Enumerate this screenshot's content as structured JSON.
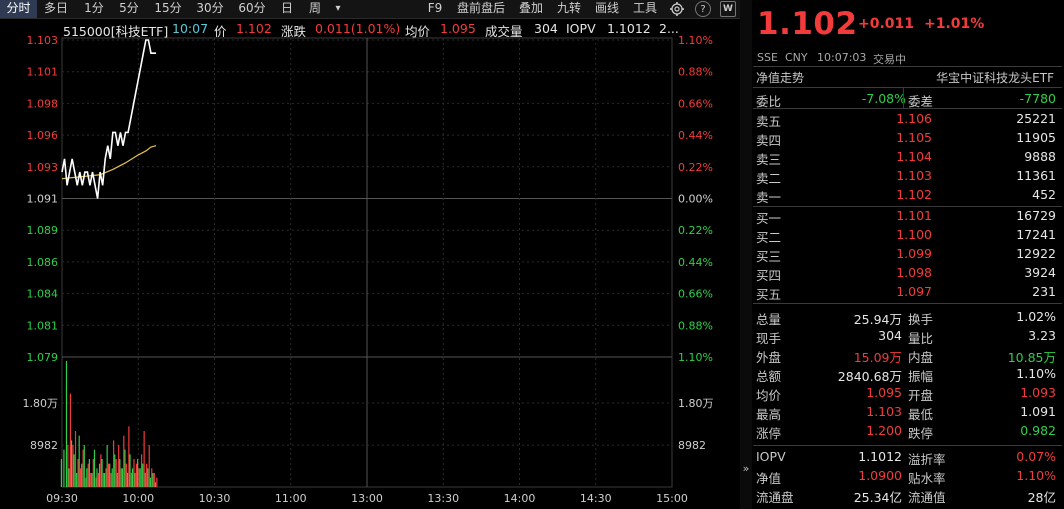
{
  "toolbar": {
    "periods": [
      {
        "label": "分时",
        "active": true
      },
      {
        "label": "多日"
      },
      {
        "label": "1分"
      },
      {
        "label": "5分"
      },
      {
        "label": "15分"
      },
      {
        "label": "30分"
      },
      {
        "label": "60分"
      },
      {
        "label": "日"
      },
      {
        "label": "周"
      }
    ],
    "more_arrow": "▾",
    "tools": [
      "F9",
      "盘前盘后",
      "叠加",
      "九转",
      "画线",
      "工具"
    ],
    "settings_icon": "gear-icon",
    "help_icon": "help-icon",
    "help_text": "?",
    "expand_icon": "expand-icon",
    "expand_text": "W"
  },
  "info": {
    "code_name": "515000[科技ETF]",
    "time": "10:07",
    "price_label": "价",
    "price": "1.102",
    "change_label": "涨跌",
    "change": "0.011(1.01%)",
    "avg_label": "均价",
    "avg": "1.095",
    "volume_label": "成交量",
    "volume": "304",
    "iopv_label": "IOPV",
    "iopv": "1.1012",
    "trailing": "2..."
  },
  "chart_data": {
    "type": "line",
    "title": "",
    "base_price": 1.091,
    "y_ticks_price": [
      "1.103",
      "1.101",
      "1.098",
      "1.096",
      "1.093",
      "1.091",
      "1.089",
      "1.086",
      "1.084",
      "1.081",
      "1.079"
    ],
    "y_ticks_pct": [
      "1.10%",
      "0.88%",
      "0.66%",
      "0.44%",
      "0.22%",
      "0.00%",
      "0.22%",
      "0.44%",
      "0.66%",
      "0.88%",
      "1.10%"
    ],
    "ylim": [
      1.079,
      1.103
    ],
    "x_ticks": [
      "09:30",
      "10:30",
      "11:00",
      "13:00",
      "13:30",
      "14:00",
      "14:30",
      "15:00"
    ],
    "x_major": [
      "10:00"
    ],
    "series": [
      {
        "kind": "price",
        "x": [
          "09:30",
          "09:31",
          "09:32",
          "09:33",
          "09:34",
          "09:35",
          "09:36",
          "09:37",
          "09:38",
          "09:39",
          "09:40",
          "09:41",
          "09:42",
          "09:43",
          "09:44",
          "09:45",
          "09:46",
          "09:47",
          "09:48",
          "09:49",
          "09:50",
          "09:51",
          "09:52",
          "09:53",
          "09:54",
          "09:55",
          "09:56",
          "09:57",
          "09:58",
          "09:59",
          "10:00",
          "10:01",
          "10:02",
          "10:03",
          "10:04",
          "10:05",
          "10:06",
          "10:07"
        ],
        "values": [
          1.093,
          1.094,
          1.092,
          1.093,
          1.094,
          1.093,
          1.092,
          1.093,
          1.092,
          1.093,
          1.093,
          1.092,
          1.093,
          1.092,
          1.091,
          1.093,
          1.092,
          1.094,
          1.095,
          1.094,
          1.096,
          1.096,
          1.095,
          1.096,
          1.095,
          1.096,
          1.096,
          1.097,
          1.098,
          1.099,
          1.1,
          1.101,
          1.102,
          1.103,
          1.103,
          1.102,
          1.102,
          1.102
        ]
      },
      {
        "kind": "avg",
        "x": [
          "09:30",
          "09:35",
          "09:40",
          "09:45",
          "09:50",
          "09:55",
          "10:00",
          "10:03",
          "10:05",
          "10:07"
        ],
        "values": [
          1.0925,
          1.0926,
          1.0927,
          1.0928,
          1.0932,
          1.0937,
          1.0943,
          1.0946,
          1.0949,
          1.095
        ]
      }
    ],
    "volume": {
      "y_ticks": [
        "1.80万",
        "8982"
      ],
      "ylim": [
        0,
        27000
      ],
      "bars_red": [
        3,
        0,
        9000,
        20000,
        9000,
        12000,
        6000,
        4000,
        8000,
        2000,
        5000,
        3000,
        6000,
        2000,
        3000,
        7000,
        3000,
        4000,
        5000,
        3000,
        10000,
        6000,
        9000,
        4000,
        11000,
        5000,
        13000,
        3000,
        6000,
        5000,
        4000,
        7000,
        12000,
        5000,
        9000,
        4000,
        3000,
        2000
      ],
      "bars_green": [
        6000,
        8000,
        27000,
        4000,
        10000,
        7000,
        3000,
        11000,
        5000,
        9000,
        4000,
        6000,
        3000,
        8000,
        4000,
        5000,
        6000,
        3000,
        9000,
        5000,
        4000,
        7000,
        3000,
        6000,
        4000,
        8000,
        3000,
        7000,
        4000,
        3000,
        6000,
        4000,
        5000,
        3000,
        4000,
        2000,
        3000,
        1000
      ]
    }
  },
  "quote": {
    "price": "1.102",
    "change": "+0.011",
    "change_pct": "+1.01%",
    "exchange": "SSE",
    "currency": "CNY",
    "time": "10:07:03",
    "status": "交易中",
    "nav_trend_label": "净值走势",
    "fund_name": "华宝中证科技龙头ETF",
    "weibi_label": "委比",
    "weibi": "-7.08%",
    "weicha_label": "委差",
    "weicha": "-7780",
    "asks": [
      {
        "label": "卖五",
        "price": "1.106",
        "vol": "25221"
      },
      {
        "label": "卖四",
        "price": "1.105",
        "vol": "11905"
      },
      {
        "label": "卖三",
        "price": "1.104",
        "vol": "9888"
      },
      {
        "label": "卖二",
        "price": "1.103",
        "vol": "11361"
      },
      {
        "label": "卖一",
        "price": "1.102",
        "vol": "452"
      }
    ],
    "bids": [
      {
        "label": "买一",
        "price": "1.101",
        "vol": "16729"
      },
      {
        "label": "买二",
        "price": "1.100",
        "vol": "17241"
      },
      {
        "label": "买三",
        "price": "1.099",
        "vol": "12922"
      },
      {
        "label": "买四",
        "price": "1.098",
        "vol": "3924"
      },
      {
        "label": "买五",
        "price": "1.097",
        "vol": "231"
      }
    ],
    "stats": [
      {
        "l1": "总量",
        "v1": "25.94万",
        "c1": "white",
        "l2": "换手",
        "v2": "1.02%",
        "c2": "white"
      },
      {
        "l1": "现手",
        "v1": "304",
        "c1": "white",
        "l2": "量比",
        "v2": "3.23",
        "c2": "white"
      },
      {
        "l1": "外盘",
        "v1": "15.09万",
        "c1": "red",
        "l2": "内盘",
        "v2": "10.85万",
        "c2": "green"
      },
      {
        "l1": "总额",
        "v1": "2840.68万",
        "c1": "white",
        "l2": "振幅",
        "v2": "1.10%",
        "c2": "white"
      },
      {
        "l1": "均价",
        "v1": "1.095",
        "c1": "red",
        "l2": "开盘",
        "v2": "1.093",
        "c2": "red"
      },
      {
        "l1": "最高",
        "v1": "1.103",
        "c1": "red",
        "l2": "最低",
        "v2": "1.091",
        "c2": "white"
      },
      {
        "l1": "涨停",
        "v1": "1.200",
        "c1": "red",
        "l2": "跌停",
        "v2": "0.982",
        "c2": "green"
      }
    ],
    "fund_stats": [
      {
        "l1": "IOPV",
        "v1": "1.1012",
        "c1": "white",
        "l2": "溢折率",
        "v2": "0.07%",
        "c2": "red"
      },
      {
        "l1": "净值",
        "v1": "1.0900",
        "c1": "red",
        "l2": "贴水率",
        "v2": "1.10%",
        "c2": "red"
      },
      {
        "l1": "流通盘",
        "v1": "25.34亿",
        "c1": "white",
        "l2": "流通值",
        "v2": "28亿",
        "c2": "white"
      }
    ],
    "collapse_arrow": "»"
  },
  "colors": {
    "up": "#f23b3b",
    "down": "#2fcf49",
    "price_line": "#ffffff",
    "avg_line": "#e8c24a",
    "grid": "#2a2a2a"
  }
}
